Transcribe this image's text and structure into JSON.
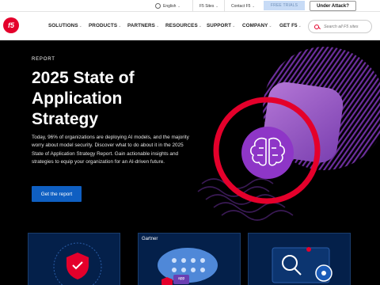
{
  "utility_bar": {
    "language": "English",
    "sites": "F5 Sites",
    "contact": "Contact F5",
    "free_trials": "FREE TRIALS",
    "under_attack": "Under Attack?"
  },
  "brand": {
    "logo_text": "f5",
    "accent_color": "#e4002b",
    "primary_blue": "#0f5fc2"
  },
  "nav": {
    "items": [
      {
        "label": "SOLUTIONS"
      },
      {
        "label": "PRODUCTS"
      },
      {
        "label": "PARTNERS"
      },
      {
        "label": "RESOURCES"
      },
      {
        "label": "SUPPORT"
      },
      {
        "label": "COMPANY"
      },
      {
        "label": "GET F5"
      }
    ],
    "search_placeholder": "Search all F5 sites"
  },
  "hero": {
    "eyebrow": "REPORT",
    "title": "2025 State of Application Strategy",
    "description": "Today, 96% of organizations are deploying AI models, and the majority worry about model security. Discover what to do about it in the 2025 State of Application Strategy Report. Gain actionable insights and strategies to equip your organization for an AI-driven future.",
    "cta": "Get the report"
  },
  "cards": [
    {
      "label": ""
    },
    {
      "label": "Gartner",
      "badge": "app"
    },
    {
      "label": ""
    }
  ]
}
